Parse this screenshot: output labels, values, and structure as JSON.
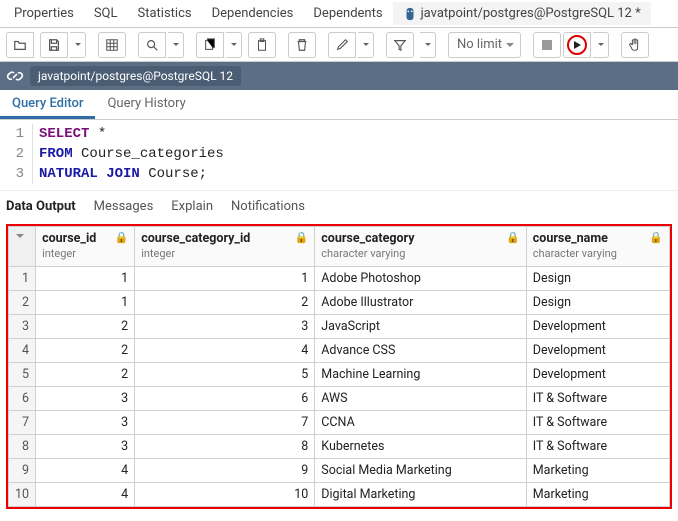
{
  "top_tabs": {
    "items": [
      "Properties",
      "SQL",
      "Statistics",
      "Dependencies",
      "Dependents"
    ],
    "active": "javatpoint/postgres@PostgreSQL 12 *"
  },
  "toolbar": {
    "nolimit": "No limit"
  },
  "pathbar": {
    "label": "javatpoint/postgres@PostgreSQL 12"
  },
  "editor_tabs": {
    "query_editor": "Query Editor",
    "query_history": "Query History"
  },
  "code": {
    "line1": {
      "kw": "SELECT",
      "rest": " *"
    },
    "line2": {
      "kw": "FROM",
      "rest": " Course_categories"
    },
    "line3": {
      "kw1": "NATURAL",
      "kw2": "JOIN",
      "rest": " Course;"
    }
  },
  "out_tabs": {
    "data_output": "Data Output",
    "messages": "Messages",
    "explain": "Explain",
    "notifications": "Notifications"
  },
  "grid": {
    "columns": [
      {
        "name": "course_id",
        "type": "integer"
      },
      {
        "name": "course_category_id",
        "type": "integer"
      },
      {
        "name": "course_category",
        "type": "character varying"
      },
      {
        "name": "course_name",
        "type": "character varying"
      }
    ],
    "rows": [
      {
        "n": "1",
        "c0": "1",
        "c1": "1",
        "c2": "Adobe Photoshop",
        "c3": "Design"
      },
      {
        "n": "2",
        "c0": "1",
        "c1": "2",
        "c2": "Adobe Illustrator",
        "c3": "Design"
      },
      {
        "n": "3",
        "c0": "2",
        "c1": "3",
        "c2": "JavaScript",
        "c3": "Development"
      },
      {
        "n": "4",
        "c0": "2",
        "c1": "4",
        "c2": "Advance CSS",
        "c3": "Development"
      },
      {
        "n": "5",
        "c0": "2",
        "c1": "5",
        "c2": "Machine Learning",
        "c3": "Development"
      },
      {
        "n": "6",
        "c0": "3",
        "c1": "6",
        "c2": "AWS",
        "c3": "IT & Software"
      },
      {
        "n": "7",
        "c0": "3",
        "c1": "7",
        "c2": "CCNA",
        "c3": "IT & Software"
      },
      {
        "n": "8",
        "c0": "3",
        "c1": "8",
        "c2": "Kubernetes",
        "c3": "IT & Software"
      },
      {
        "n": "9",
        "c0": "4",
        "c1": "9",
        "c2": "Social Media Marketing",
        "c3": "Marketing"
      },
      {
        "n": "10",
        "c0": "4",
        "c1": "10",
        "c2": "Digital Marketing",
        "c3": "Marketing"
      }
    ]
  }
}
